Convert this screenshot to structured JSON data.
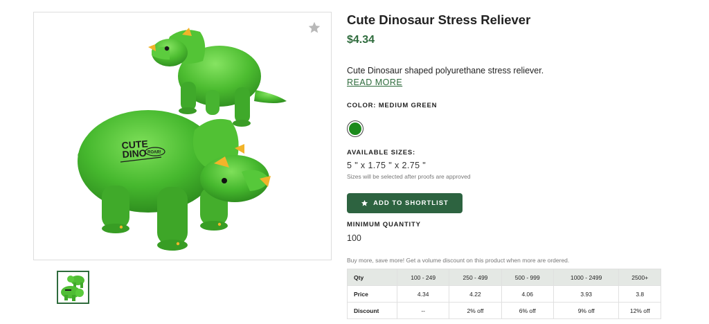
{
  "product": {
    "title": "Cute Dinosaur Stress Reliever",
    "price": "$4.34",
    "description": "Cute Dinosaur shaped polyurethane stress reliever.",
    "read_more": "READ MORE",
    "imprint_line1": "CUTE",
    "imprint_line2": "DINO",
    "imprint_badge": "ROAR!"
  },
  "color": {
    "label": "COLOR: MEDIUM GREEN",
    "swatch_hex": "#1c8a1c"
  },
  "sizes": {
    "label": "AVAILABLE SIZES:",
    "value": "5 \" x 1.75 \" x 2.75 \"",
    "note": "Sizes will be selected after proofs are approved"
  },
  "shortlist": {
    "label": "ADD TO SHORTLIST",
    "icon": "star-icon"
  },
  "minimum_quantity": {
    "label": "MINIMUM QUANTITY",
    "value": "100"
  },
  "volume_note": "Buy more, save more! Get a volume discount on this product when more are ordered.",
  "pricing_table": {
    "header": [
      "Qty",
      "100 - 249",
      "250 - 499",
      "500 - 999",
      "1000 - 2499",
      "2500+"
    ],
    "rows": [
      [
        "Price",
        "4.34",
        "4.22",
        "4.06",
        "3.93",
        "3.8"
      ],
      [
        "Discount",
        "--",
        "2% off",
        "6% off",
        "9% off",
        "12% off"
      ]
    ]
  },
  "colors": {
    "brand_green": "#2d6340",
    "price_green": "#2e6b3c",
    "dino_green": "#4fc23a",
    "dino_horn": "#f2b42a"
  }
}
